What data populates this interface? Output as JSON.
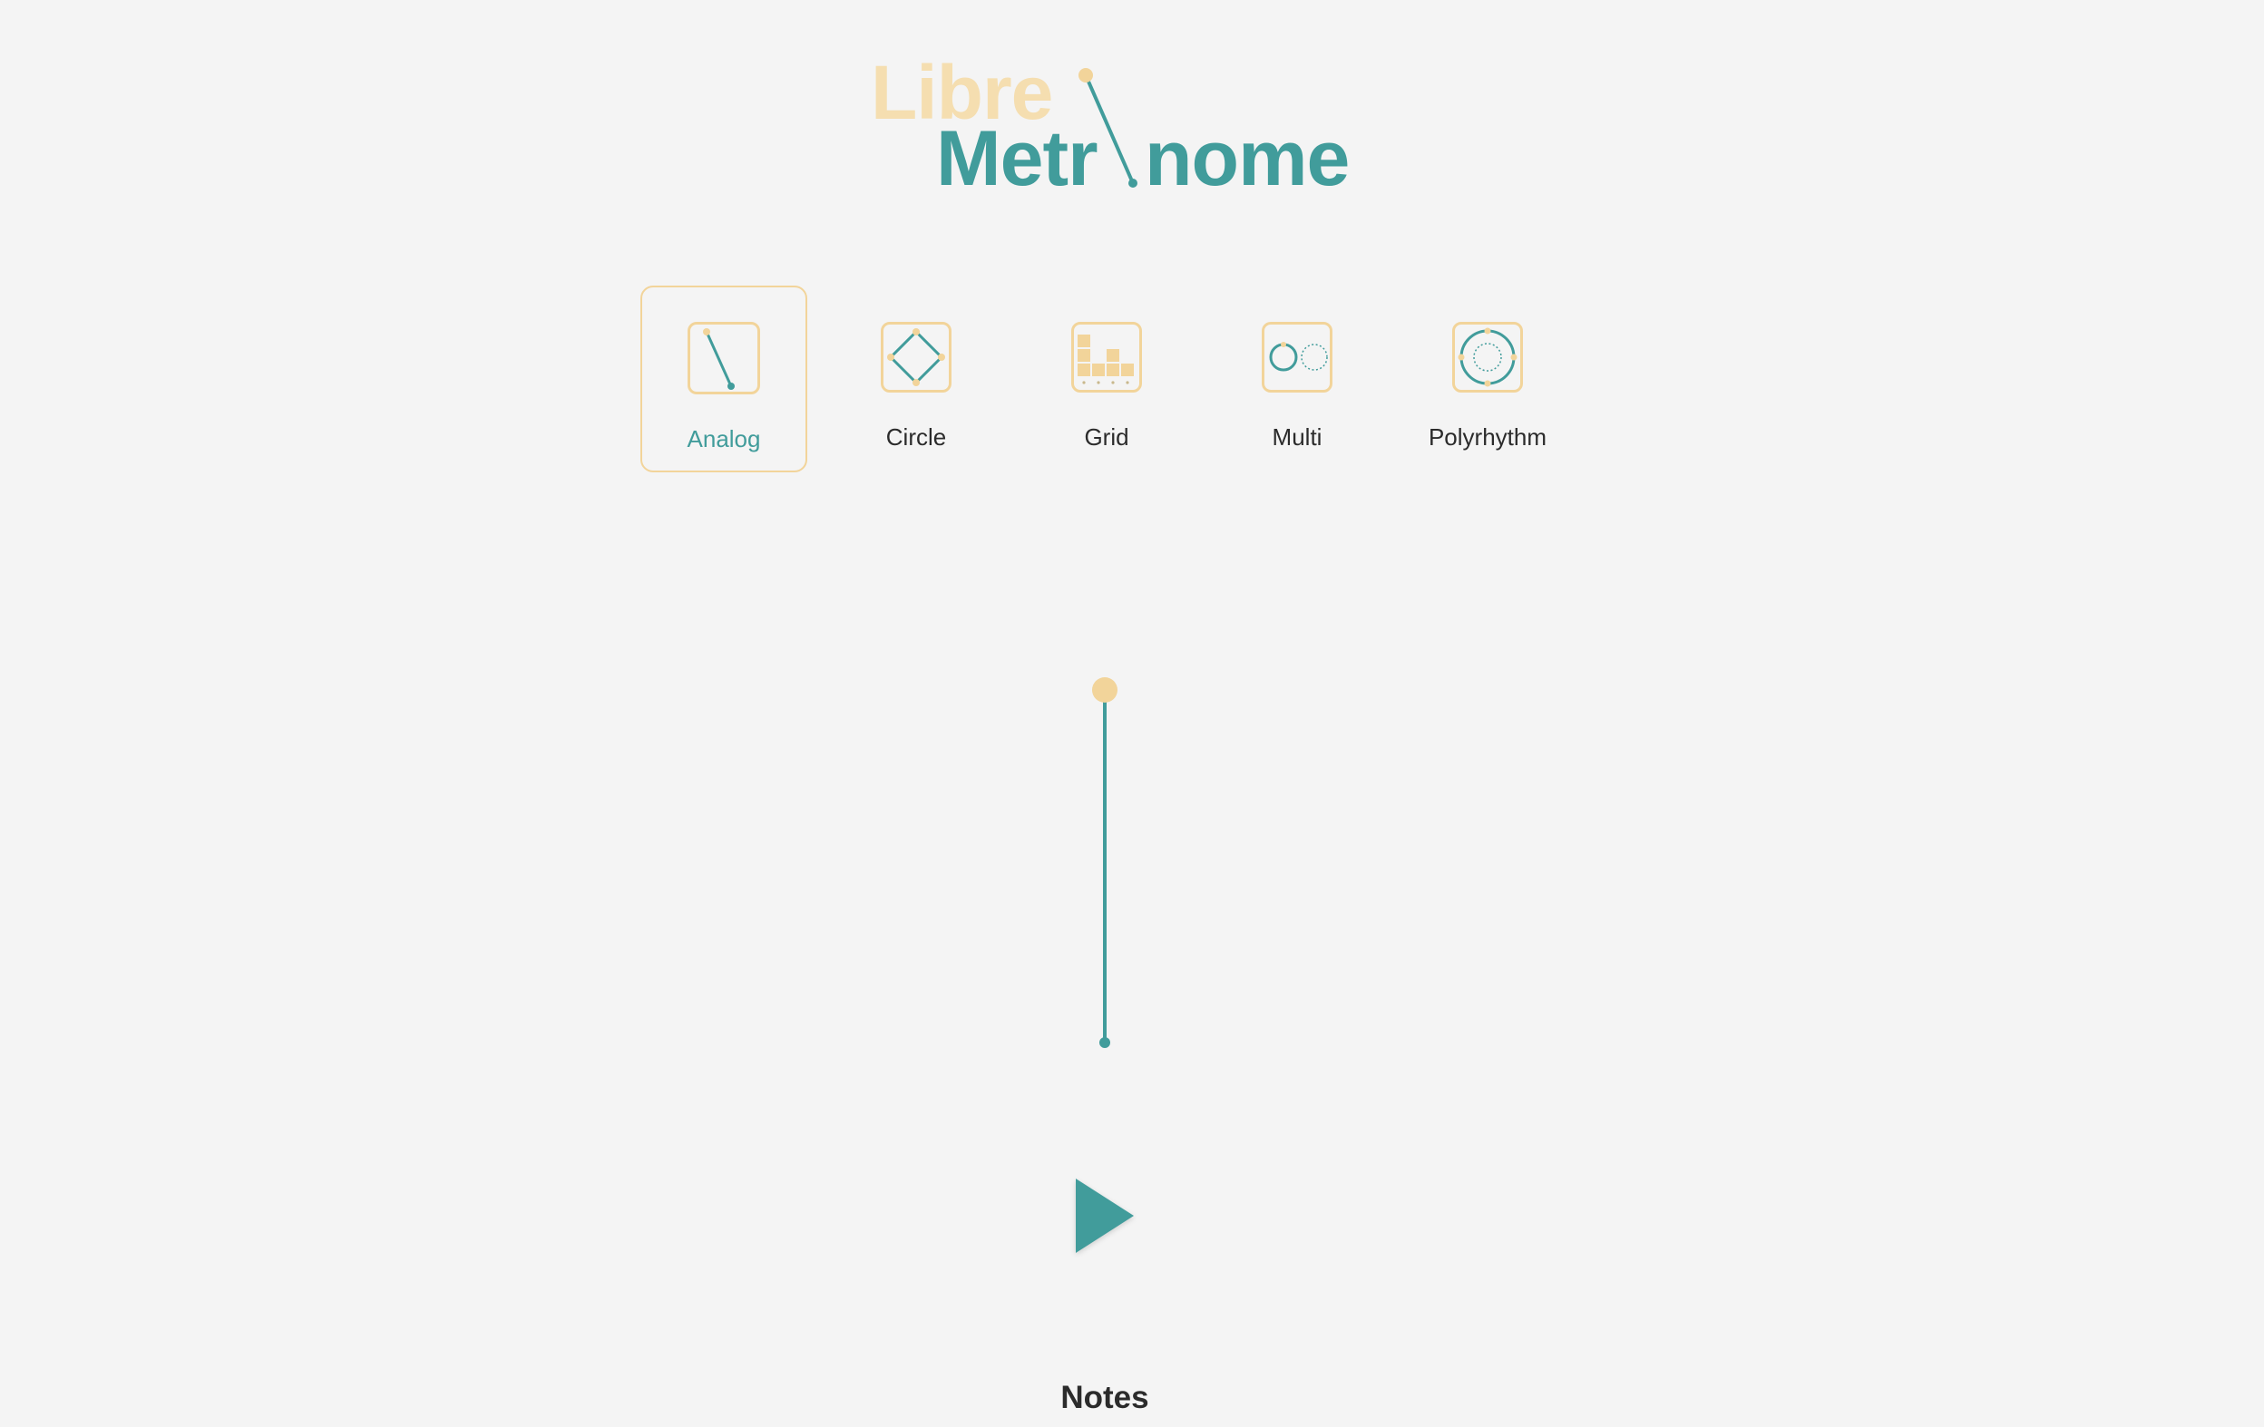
{
  "logo": {
    "line1": "Libre",
    "line2_prefix": "Metr",
    "line2_suffix": "nome"
  },
  "modes": [
    {
      "label": "Analog",
      "icon": "analog-pendulum-icon",
      "selected": true
    },
    {
      "label": "Circle",
      "icon": "circle-diamond-icon",
      "selected": false
    },
    {
      "label": "Grid",
      "icon": "grid-bars-icon",
      "selected": false
    },
    {
      "label": "Multi",
      "icon": "multi-circles-icon",
      "selected": false
    },
    {
      "label": "Polyrhythm",
      "icon": "polyrhythm-rings-icon",
      "selected": false
    }
  ],
  "play": {
    "icon": "play-icon"
  },
  "notes": {
    "heading": "Notes"
  },
  "colors": {
    "accent": "#419c9b",
    "highlight": "#f2d49a",
    "background": "#f4f4f4",
    "text": "#2b2b2b"
  }
}
